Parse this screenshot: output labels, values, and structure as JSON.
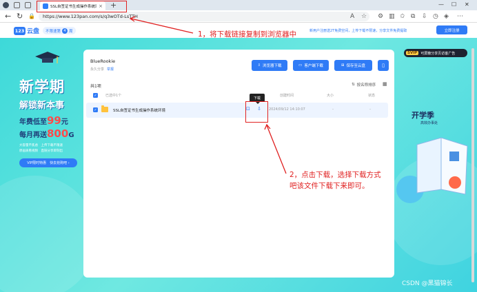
{
  "browser": {
    "tab_title": "SSL自签证书生成操作系统环境",
    "tab_close": "×",
    "new_tab": "+",
    "url": "https://www.123pan.com/s/q3wOTd-LsTTH",
    "url_highlight_color": "#e02020",
    "icons": [
      "back-icon",
      "refresh-icon",
      "font-size-icon",
      "favorite-icon",
      "extensions-icon",
      "collections-icon",
      "profile-icon",
      "more-icon"
    ]
  },
  "header": {
    "logo_mark": "123",
    "logo_text": "云盘",
    "promo_label": "不限速第",
    "promo_number": "4",
    "promo_suffix": "周",
    "note": "新用户注册送2T免费空间，上传下载不限速，分享文件免费提取",
    "register_label": "立即注册",
    "accent": "#2f7bf6"
  },
  "ad_left": {
    "title": "新学期",
    "subtitle": "解锁新本事",
    "price_line1_prefix": "年费低至",
    "price_line1_value": "99",
    "price_line1_unit": "元",
    "price_line2_prefix": "每月再送",
    "price_line2_value": "800",
    "price_line2_unit": "G",
    "features_1": "大容量不焦虑　上传下载不限速",
    "features_2": "原画质看视频　直链分享即刻出",
    "button_label": "VIP限时特惠　快去抢购吧 ›"
  },
  "ad_right": {
    "vip_tag": "SVIP",
    "vip_text": "可屏蔽分享页访客广告",
    "title": "开学季",
    "subtitle": "高效办事处"
  },
  "share": {
    "owner": "BlueRookie",
    "validity": "永久分享",
    "report": "举报",
    "buttons": {
      "browser_download": "浏览器下载",
      "client_download": "客户端下载",
      "save_to_cloud": "保存至云盘"
    },
    "total": "共1项",
    "sort": "按名称排序",
    "columns": {
      "selected": "已选中1个",
      "created": "创建时间",
      "size": "大小",
      "status": "状态"
    },
    "files": [
      {
        "name": "SSL自签证书生成操作系统环境",
        "created": "2024/09/12 14:10:07",
        "size": "-",
        "status": "-"
      }
    ],
    "tooltip": "下载"
  },
  "annotations": {
    "step1": "1，将下载链接复制到浏览器中",
    "step2_line1": "2，点击下载，选择下载方式",
    "step2_line2": "吧该文件下载下来即可。",
    "color": "#e02020"
  },
  "watermark": "CSDN @黑猫锦长"
}
